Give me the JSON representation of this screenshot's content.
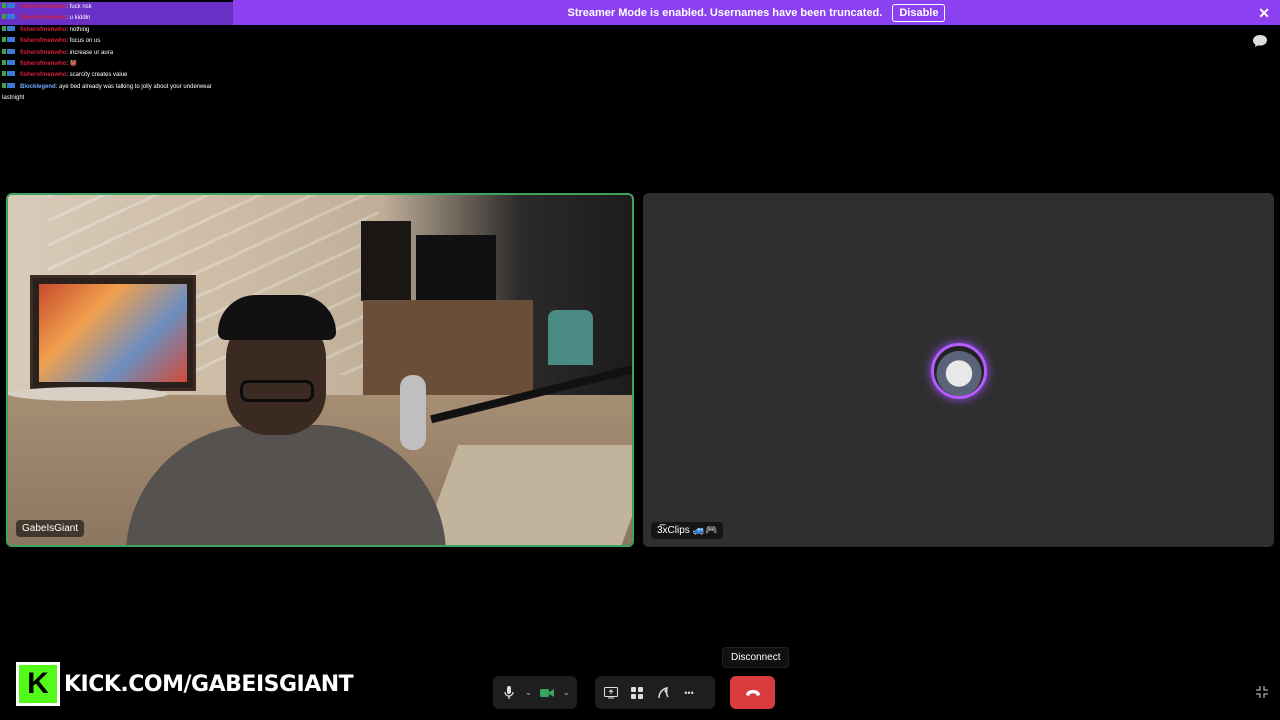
{
  "banner": {
    "text": "Streamer Mode is enabled. Usernames have been truncated.",
    "button_label": "Disable",
    "close_glyph": "✕"
  },
  "chat": {
    "messages": [
      {
        "user": "fisherofmenwho",
        "text": ": fuck nsk",
        "highlight": true
      },
      {
        "user": "fisherofmenwho",
        "text": ": u kiddin",
        "highlight": true
      },
      {
        "user": "fisherofmenwho",
        "text": ": nothing",
        "highlight": false
      },
      {
        "user": "fisherofmenwho",
        "text": ": focus on us",
        "highlight": false
      },
      {
        "user": "fisherofmenwho",
        "text": ": increase ur aura",
        "highlight": false
      },
      {
        "user": "fisherofmenwho",
        "text": ": 👹",
        "highlight": false
      },
      {
        "user": "fisherofmenwho",
        "text": ": scarcity creates value",
        "highlight": false
      },
      {
        "user": "Blocklegend",
        "text": ": aye bed already was talking to jolly about your underwear lastnight",
        "highlight": false
      }
    ]
  },
  "tiles": {
    "left_name": "GabeIsGiant",
    "right_name": "3̅̅xClips 🚙🎮"
  },
  "logo": {
    "k": "K",
    "text": "KICK.COM/GABEISGIANT",
    "color": "#53fc18"
  },
  "controls": {
    "mic_icon": "🎙",
    "camera_icon": "■",
    "chevron": "⌄",
    "screen_share_icon": "⎚",
    "activities_icon": "▦",
    "soundboard_icon": "♫",
    "more_icon": "•••",
    "disconnect_tooltip": "Disconnect"
  },
  "colors": {
    "banner": "#8b41f0",
    "speaking_border": "#3ba55d",
    "disconnect": "#d83c3e",
    "avatar_ring": "#b45cff"
  }
}
